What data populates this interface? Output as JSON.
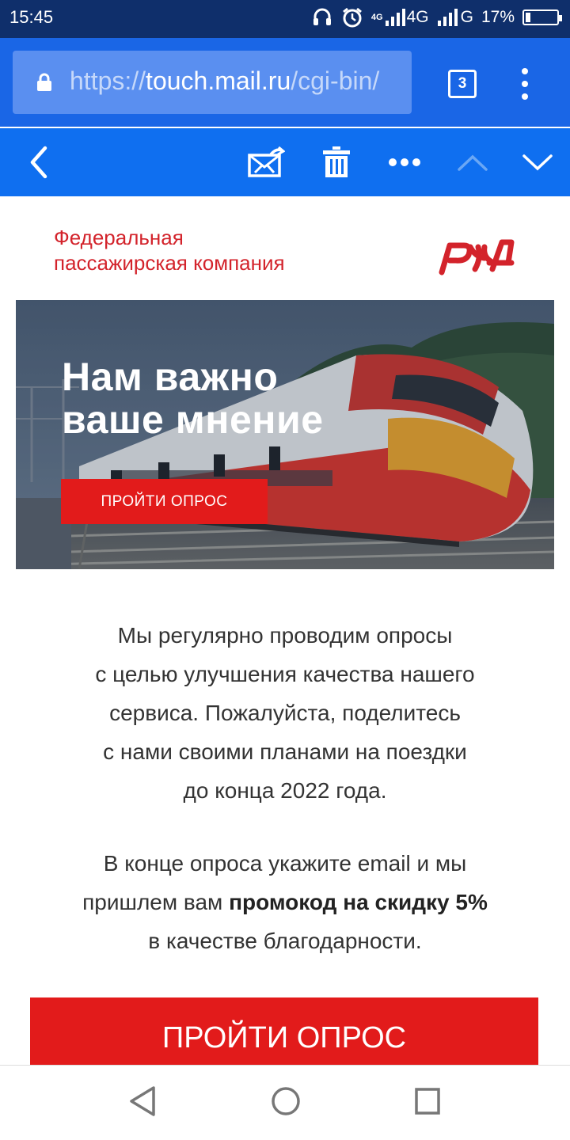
{
  "status_bar": {
    "time": "15:45",
    "network_1": "4G",
    "network_2": "G",
    "battery_percent": "17%",
    "battery_level": 0.17,
    "icons": [
      "headset-icon",
      "alarm-icon",
      "signal-icon",
      "signal-icon",
      "battery-icon"
    ]
  },
  "browser": {
    "url_scheme": "https://",
    "url_host": "touch.mail.ru",
    "url_path": "/cgi-bin/",
    "tabs_count": "3"
  },
  "mail_toolbar": {
    "icons": [
      "back-icon",
      "move-to-spam-icon",
      "trash-icon",
      "more-icon",
      "chevron-up-icon",
      "chevron-down-icon"
    ]
  },
  "email": {
    "company_line_1": "Федеральная",
    "company_line_2": "пассажирская компания",
    "logo_text": "РЖД",
    "banner_title_line_1": "Нам важно",
    "banner_title_line_2": "ваше мнение",
    "banner_button": "ПРОЙТИ ОПРОС",
    "paragraph_1": [
      "Мы регулярно проводим опросы",
      "с целью улучшения качества нашего",
      "сервиса. Пожалуйста, поделитесь",
      "с нами своими планами на поездки",
      "до конца 2022 года."
    ],
    "paragraph_2_line_1": "В конце опроса укажите email и мы",
    "paragraph_2_line_2_prefix": "пришлем вам ",
    "paragraph_2_line_2_bold": "промокод на скидку 5%",
    "paragraph_2_line_3": "в качестве благодарности.",
    "cta_button": "ПРОЙТИ ОПРОС"
  },
  "colors": {
    "status_bar": "#0f2f6b",
    "browser_bar": "#1a66e6",
    "mail_toolbar": "#0f6ff0",
    "brand_red": "#e21b1b"
  },
  "nav_bar": {
    "icons": [
      "nav-back-icon",
      "nav-home-icon",
      "nav-recents-icon"
    ]
  }
}
